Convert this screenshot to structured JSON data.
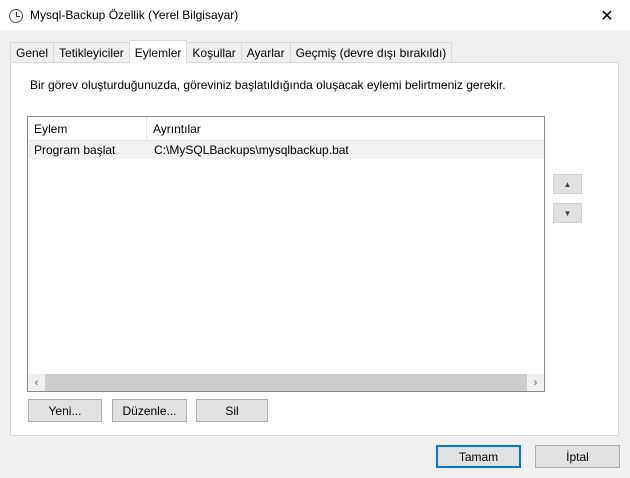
{
  "window": {
    "title": "Mysql-Backup Özellik (Yerel Bilgisayar)",
    "close_glyph": "✕",
    "app_icon": "clock-icon"
  },
  "tabs": [
    {
      "label": "Genel",
      "active": false
    },
    {
      "label": "Tetikleyiciler",
      "active": false
    },
    {
      "label": "Eylemler",
      "active": true
    },
    {
      "label": "Koşullar",
      "active": false
    },
    {
      "label": "Ayarlar",
      "active": false
    },
    {
      "label": "Geçmiş (devre dışı bırakıldı)",
      "active": false
    }
  ],
  "panel": {
    "description": "Bir görev oluşturduğunuzda, göreviniz başlatıldığında oluşacak eylemi belirtmeniz gerekir."
  },
  "actions_table": {
    "columns": [
      "Eylem",
      "Ayrıntılar"
    ],
    "rows": [
      {
        "action": "Program başlat",
        "details": "C:\\MySQLBackups\\mysqlbackup.bat"
      }
    ],
    "scroll_left_glyph": "‹",
    "scroll_right_glyph": "›"
  },
  "side_buttons": {
    "move_up_glyph": "▲",
    "move_down_glyph": "▼"
  },
  "list_buttons": {
    "new_label": "Yeni...",
    "edit_label": "Düzenle...",
    "delete_label": "Sil"
  },
  "dialog_buttons": {
    "ok_label": "Tamam",
    "cancel_label": "İptal"
  },
  "colors": {
    "accent": "#0078d7",
    "window_bg": "#f0f0f0",
    "panel_bg": "#ffffff",
    "selected_row": "#f2f2f2"
  }
}
